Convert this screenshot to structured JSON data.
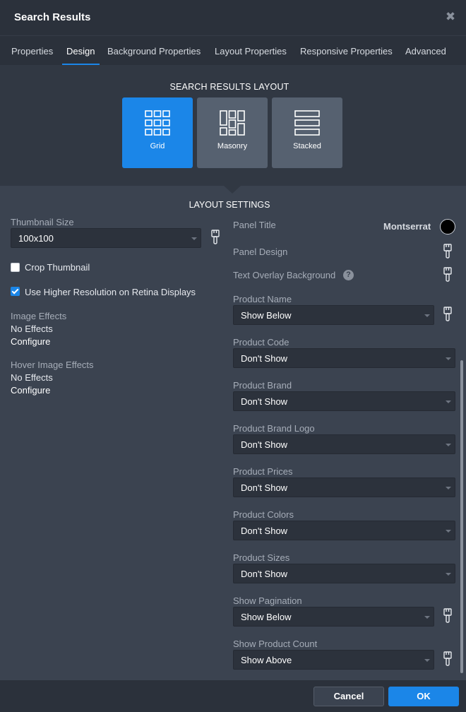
{
  "dialog": {
    "title": "Search Results",
    "close_icon": "close-icon"
  },
  "tabs": [
    {
      "label": "Properties",
      "active": false
    },
    {
      "label": "Design",
      "active": true
    },
    {
      "label": "Background Properties",
      "active": false
    },
    {
      "label": "Layout Properties",
      "active": false
    },
    {
      "label": "Responsive Properties",
      "active": false
    },
    {
      "label": "Advanced",
      "active": false
    }
  ],
  "layout": {
    "heading": "SEARCH RESULTS LAYOUT",
    "options": [
      {
        "label": "Grid",
        "icon": "grid-icon",
        "selected": true
      },
      {
        "label": "Masonry",
        "icon": "masonry-icon",
        "selected": false
      },
      {
        "label": "Stacked",
        "icon": "stacked-icon",
        "selected": false
      }
    ]
  },
  "settings": {
    "heading": "LAYOUT SETTINGS",
    "left": {
      "thumbnail_size": {
        "label": "Thumbnail Size",
        "value": "100x100"
      },
      "crop_thumbnail": {
        "label": "Crop Thumbnail",
        "checked": false
      },
      "retina": {
        "label": "Use Higher Resolution on Retina Displays",
        "checked": true
      },
      "image_effects": {
        "label": "Image Effects",
        "value": "No Effects",
        "action": "Configure"
      },
      "hover_image_effects": {
        "label": "Hover Image Effects",
        "value": "No Effects",
        "action": "Configure"
      }
    },
    "right": {
      "panel_title": {
        "label": "Panel Title",
        "font": "Montserrat",
        "color": "#000000"
      },
      "panel_design": {
        "label": "Panel Design"
      },
      "text_overlay_background": {
        "label": "Text Overlay Background",
        "help": "?"
      },
      "fields": [
        {
          "label": "Product Name",
          "value": "Show Below",
          "brush": true
        },
        {
          "label": "Product Code",
          "value": "Don't Show",
          "brush": false
        },
        {
          "label": "Product Brand",
          "value": "Don't Show",
          "brush": false
        },
        {
          "label": "Product Brand Logo",
          "value": "Don't Show",
          "brush": false
        },
        {
          "label": "Product Prices",
          "value": "Don't Show",
          "brush": false
        },
        {
          "label": "Product Colors",
          "value": "Don't Show",
          "brush": false
        },
        {
          "label": "Product Sizes",
          "value": "Don't Show",
          "brush": false
        },
        {
          "label": "Show Pagination",
          "value": "Show Below",
          "brush": true
        },
        {
          "label": "Show Product Count",
          "value": "Show Above",
          "brush": true
        }
      ]
    }
  },
  "footer": {
    "cancel_label": "Cancel",
    "ok_label": "OK"
  },
  "colors": {
    "accent": "#1b86e8",
    "panel": "#3b4350",
    "header": "#2b313b"
  }
}
